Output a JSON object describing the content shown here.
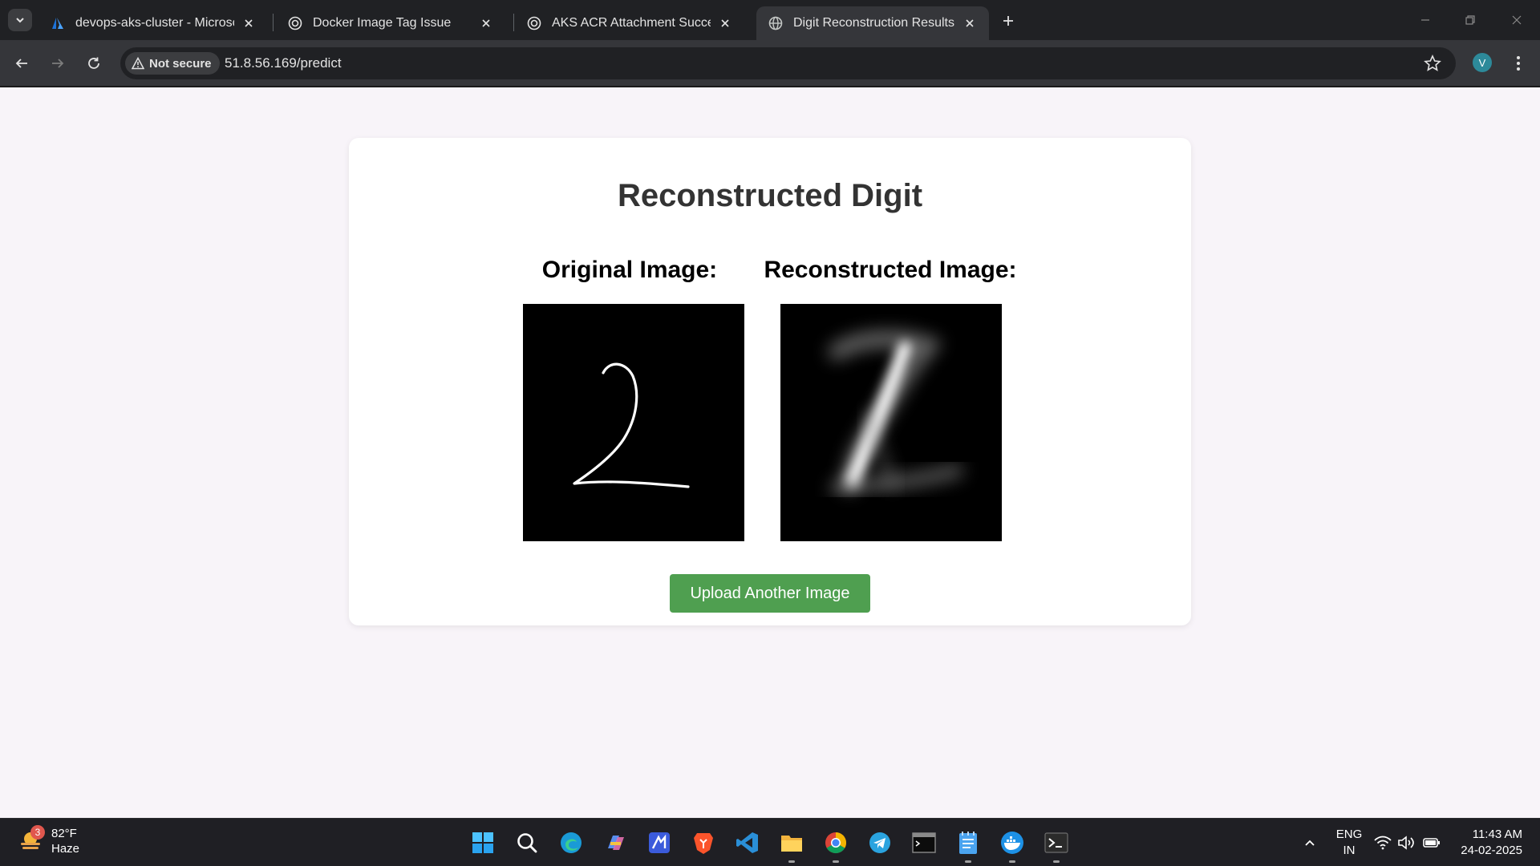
{
  "browser": {
    "tabs": [
      {
        "title": "devops-aks-cluster - Microsoft Azure",
        "favicon": "azure-icon",
        "active": false
      },
      {
        "title": "Docker Image Tag Issue",
        "favicon": "chatgpt-icon",
        "active": false
      },
      {
        "title": "AKS ACR Attachment Success",
        "favicon": "chatgpt-icon",
        "active": false
      },
      {
        "title": "Digit Reconstruction Results",
        "favicon": "globe-icon",
        "active": true
      }
    ],
    "security_label": "Not secure",
    "url": "51.8.56.169/predict",
    "profile_initial": "V"
  },
  "page": {
    "title": "Reconstructed Digit",
    "original_label": "Original Image:",
    "reconstructed_label": "Reconstructed Image:",
    "upload_button": "Upload Another Image",
    "button_color": "#4f9f50"
  },
  "taskbar": {
    "weather_temp": "82°F",
    "weather_desc": "Haze",
    "weather_badge": "3",
    "apps": [
      "windows-start-icon",
      "search-icon",
      "edge-icon",
      "copilot-icon",
      "app-icon",
      "brave-icon",
      "vscode-icon",
      "file-explorer-icon",
      "chrome-icon",
      "telegram-icon",
      "terminal-icon",
      "notepad-icon",
      "docker-icon",
      "powershell-icon"
    ],
    "lang_line1": "ENG",
    "lang_line2": "IN",
    "time": "11:43 AM",
    "date": "24-02-2025"
  }
}
